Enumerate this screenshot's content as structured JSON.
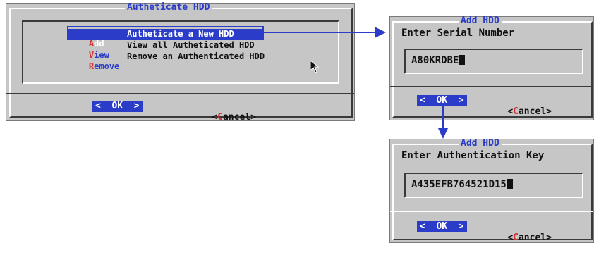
{
  "authenticate_dialog": {
    "title": "Autheticate HDD",
    "menu_items": [
      {
        "key": "A",
        "rest": "dd",
        "description": "Autheticate a New HDD"
      },
      {
        "key": "V",
        "rest": "iew",
        "description": "View all Autheticated HDD"
      },
      {
        "key": "R",
        "rest": "emove",
        "description": "Remove an Authenticated HDD"
      }
    ],
    "ok_button": "<  OK  >",
    "cancel_prefix": "<",
    "cancel_hotkey": "C",
    "cancel_rest": "ancel>"
  },
  "serial_dialog": {
    "title": "Add HDD",
    "prompt": "Enter Serial Number",
    "value": "A80KRDBE",
    "ok_button": "<  OK  >",
    "cancel_prefix": "<",
    "cancel_hotkey": "C",
    "cancel_rest": "ancel>"
  },
  "key_dialog": {
    "title": "Add HDD",
    "prompt": "Enter Authentication Key",
    "value": "A435EFB764521D15",
    "ok_button": "<  OK  >",
    "cancel_prefix": "<",
    "cancel_hotkey": "C",
    "cancel_rest": "ancel>"
  },
  "colors": {
    "accent": "#2a3cc8",
    "hotkey": "#d23030",
    "dialog_bg": "#c6c6c6"
  }
}
